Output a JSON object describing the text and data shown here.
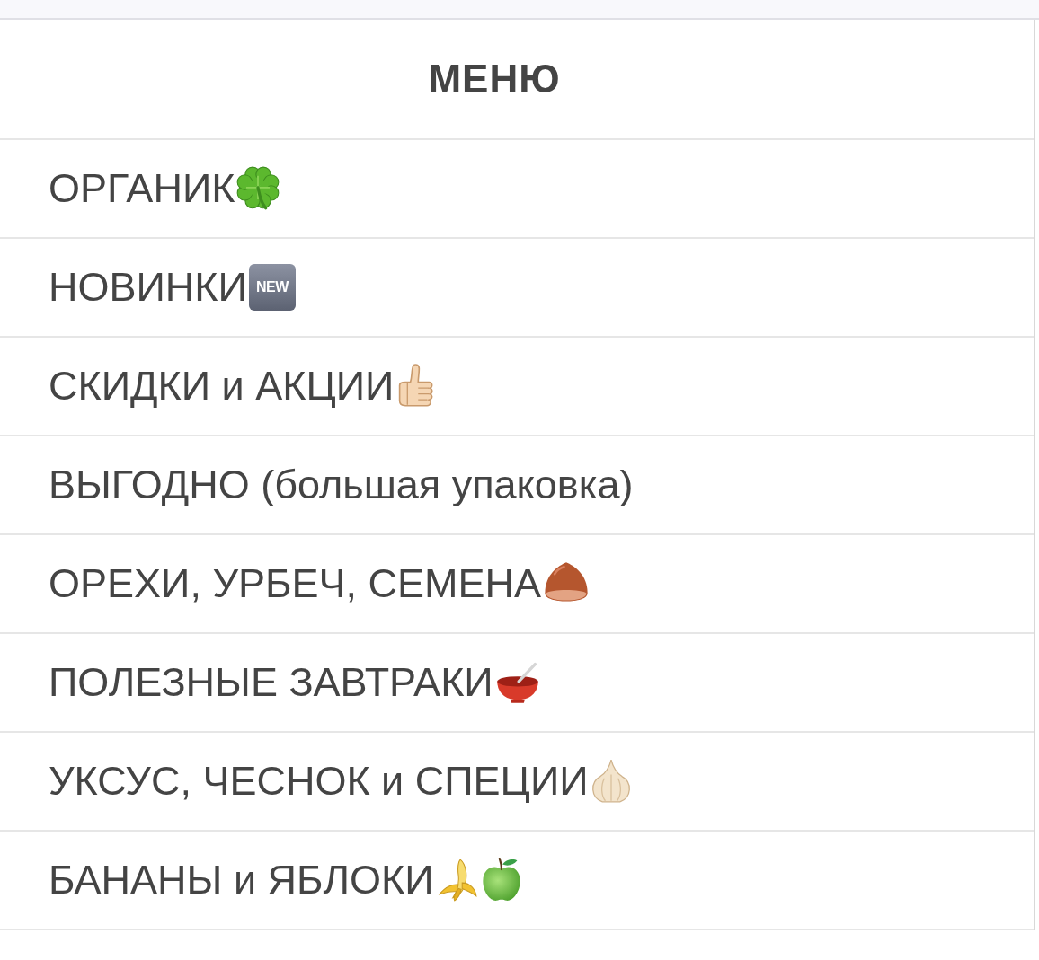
{
  "header": {
    "title": "МЕНЮ"
  },
  "menu": {
    "items": [
      {
        "label": "ОРГАНИК"
      },
      {
        "label": "НОВИНКИ",
        "badge": "NEW"
      },
      {
        "label": "СКИДКИ и АКЦИИ"
      },
      {
        "label": "ВЫГОДНО (большая упаковка)"
      },
      {
        "label": "ОРЕХИ, УРБЕЧ, СЕМЕНА"
      },
      {
        "label": "ПОЛЕЗНЫЕ ЗАВТРАКИ"
      },
      {
        "label": "УКСУС, ЧЕСНОК и СПЕЦИИ"
      },
      {
        "label": "БАНАНЫ и ЯБЛОКИ"
      }
    ]
  }
}
